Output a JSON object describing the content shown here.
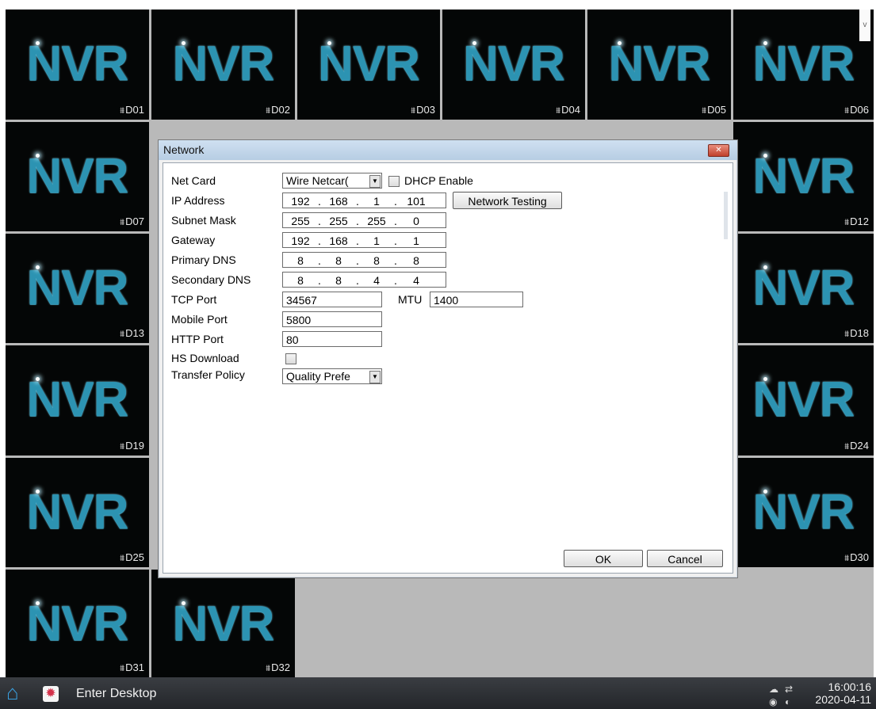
{
  "grid": {
    "logo_text": "NVR",
    "camera_glyph": "⩩",
    "channels": [
      "D01",
      "D02",
      "D03",
      "D04",
      "D05",
      "D06",
      "D07",
      "D12",
      "D13",
      "D18",
      "D19",
      "D24",
      "D25",
      "D30",
      "D31",
      "D32"
    ]
  },
  "dialog": {
    "title": "Network",
    "net_card": {
      "label": "Net Card",
      "value": "Wire Netcar("
    },
    "dhcp": {
      "label": "DHCP Enable",
      "checked": false
    },
    "ip_address": {
      "label": "IP Address",
      "value": [
        "192",
        "168",
        "1",
        "101"
      ]
    },
    "network_testing_label": "Network Testing",
    "subnet_mask": {
      "label": "Subnet Mask",
      "value": [
        "255",
        "255",
        "255",
        "0"
      ]
    },
    "gateway": {
      "label": "Gateway",
      "value": [
        "192",
        "168",
        "1",
        "1"
      ]
    },
    "primary_dns": {
      "label": "Primary DNS",
      "value": [
        "8",
        "8",
        "8",
        "8"
      ]
    },
    "secondary_dns": {
      "label": "Secondary DNS",
      "value": [
        "8",
        "8",
        "4",
        "4"
      ]
    },
    "tcp_port": {
      "label": "TCP Port",
      "value": "34567"
    },
    "mtu": {
      "label": "MTU",
      "value": "1400"
    },
    "mobile_port": {
      "label": "Mobile Port",
      "value": "5800"
    },
    "http_port": {
      "label": "HTTP Port",
      "value": "80"
    },
    "hs_download": {
      "label": "HS Download",
      "checked": false
    },
    "transfer_policy": {
      "label": "Transfer Policy",
      "value": "Quality Prefe"
    },
    "ok_label": "OK",
    "cancel_label": "Cancel"
  },
  "taskbar": {
    "enter_desktop": "Enter Desktop",
    "time": "16:00:16",
    "date": "2020-04-11"
  },
  "colors": {
    "tile_bg": "#040606",
    "logo": "#2c93b2",
    "taskbar": "#2a2d31",
    "dialog_title": "#c4d7ea"
  },
  "icons": [
    "home-icon",
    "gear-icon",
    "cloud-icon",
    "network-icon",
    "speaker-icon",
    "chevron-down-icon",
    "close-icon",
    "camera-icon"
  ]
}
